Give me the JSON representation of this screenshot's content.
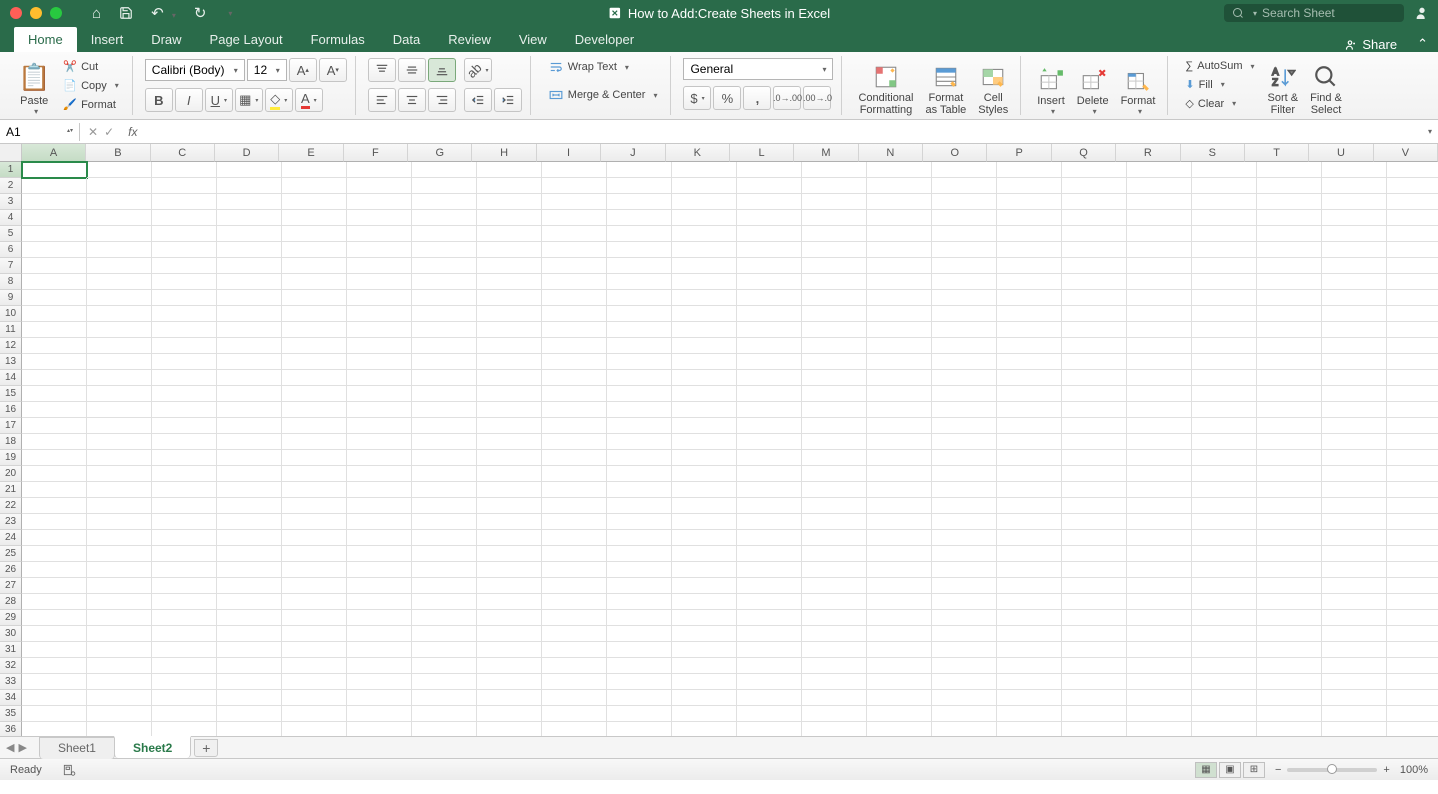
{
  "titlebar": {
    "document_title": "How to Add:Create Sheets in Excel",
    "search_placeholder": "Search Sheet"
  },
  "tabs": {
    "items": [
      "Home",
      "Insert",
      "Draw",
      "Page Layout",
      "Formulas",
      "Data",
      "Review",
      "View",
      "Developer"
    ],
    "active": "Home",
    "share": "Share"
  },
  "ribbon": {
    "clipboard": {
      "paste": "Paste",
      "cut": "Cut",
      "copy": "Copy",
      "format": "Format"
    },
    "font": {
      "name": "Calibri (Body)",
      "size": "12"
    },
    "alignment": {
      "wrap": "Wrap Text",
      "merge": "Merge & Center"
    },
    "number": {
      "format": "General"
    },
    "styles": {
      "conditional": "Conditional",
      "formatting": "Formatting",
      "format_as": "Format",
      "as_table": "as Table",
      "cell": "Cell",
      "cell_styles": "Styles"
    },
    "cells": {
      "insert": "Insert",
      "delete": "Delete",
      "format": "Format"
    },
    "editing": {
      "autosum": "AutoSum",
      "fill": "Fill",
      "clear": "Clear",
      "sort": "Sort &",
      "filter": "Filter",
      "find": "Find &",
      "select": "Select"
    }
  },
  "formula_bar": {
    "cell_ref": "A1"
  },
  "grid": {
    "columns": [
      "A",
      "B",
      "C",
      "D",
      "E",
      "F",
      "G",
      "H",
      "I",
      "J",
      "K",
      "L",
      "M",
      "N",
      "O",
      "P",
      "Q",
      "R",
      "S",
      "T",
      "U",
      "V"
    ],
    "rows": 36,
    "active_cell": "A1"
  },
  "sheets": {
    "tabs": [
      "Sheet1",
      "Sheet2"
    ],
    "active": "Sheet2"
  },
  "status": {
    "ready": "Ready",
    "zoom": "100%"
  }
}
